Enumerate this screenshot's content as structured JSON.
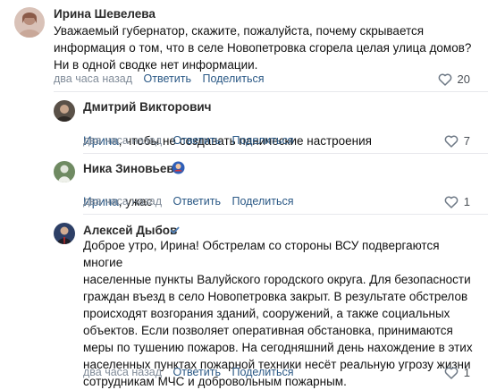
{
  "comments": [
    {
      "author": "Ирина Шевелева",
      "text": "Уважаемый губернатор, скажите, пожалуйста, почему скрывается\nинформация о том, что в селе Новопетровка сгорела целая улица домов?\nНи в одной сводке нет информации.",
      "time": "два часа назад",
      "reply_label": "Ответить",
      "share_label": "Поделиться",
      "likes": "20"
    },
    {
      "author": "Дмитрий Викторович",
      "mention": "Ирина",
      "text": ", чтобы не создавать панические настроения",
      "time": "два часа назад",
      "reply_label": "Ответить",
      "share_label": "Поделиться",
      "likes": "7"
    },
    {
      "author": "Ника Зиновьева",
      "mention": "Ирина",
      "text": ", ужас",
      "time": "два часа назад",
      "reply_label": "Ответить",
      "share_label": "Поделиться",
      "likes": "1"
    },
    {
      "author": "Алексей Дыбов",
      "text": "Доброе утро, Ирина! Обстрелам со стороны ВСУ подвергаются многие\nнаселенные пункты Валуйского городского округа. Для безопасности\nграждан въезд в село Новопетровка закрыт. В результате обстрелов\nпроисходят возгорания зданий, сооружений, а также социальных\nобъектов. Если позволяет оперативная обстановка, принимаются\nмеры по тушению пожаров. На сегодняшний день нахождение в этих\nнаселенных пунктах пожарной техники несёт реальную угрозу жизни\nсотрудникам МЧС и добровольным пожарным.",
      "time": "два часа назад",
      "reply_label": "Ответить",
      "share_label": "Поделиться",
      "likes": "1"
    }
  ],
  "colors": {
    "link": "#2a5885",
    "meta": "#818c99",
    "verified": "#5181b8",
    "divider": "#e7e8ec"
  },
  "icons": {
    "like": "heart-outline-icon",
    "verified": "verified-check-icon",
    "badge": "emoji-badge-icon"
  }
}
